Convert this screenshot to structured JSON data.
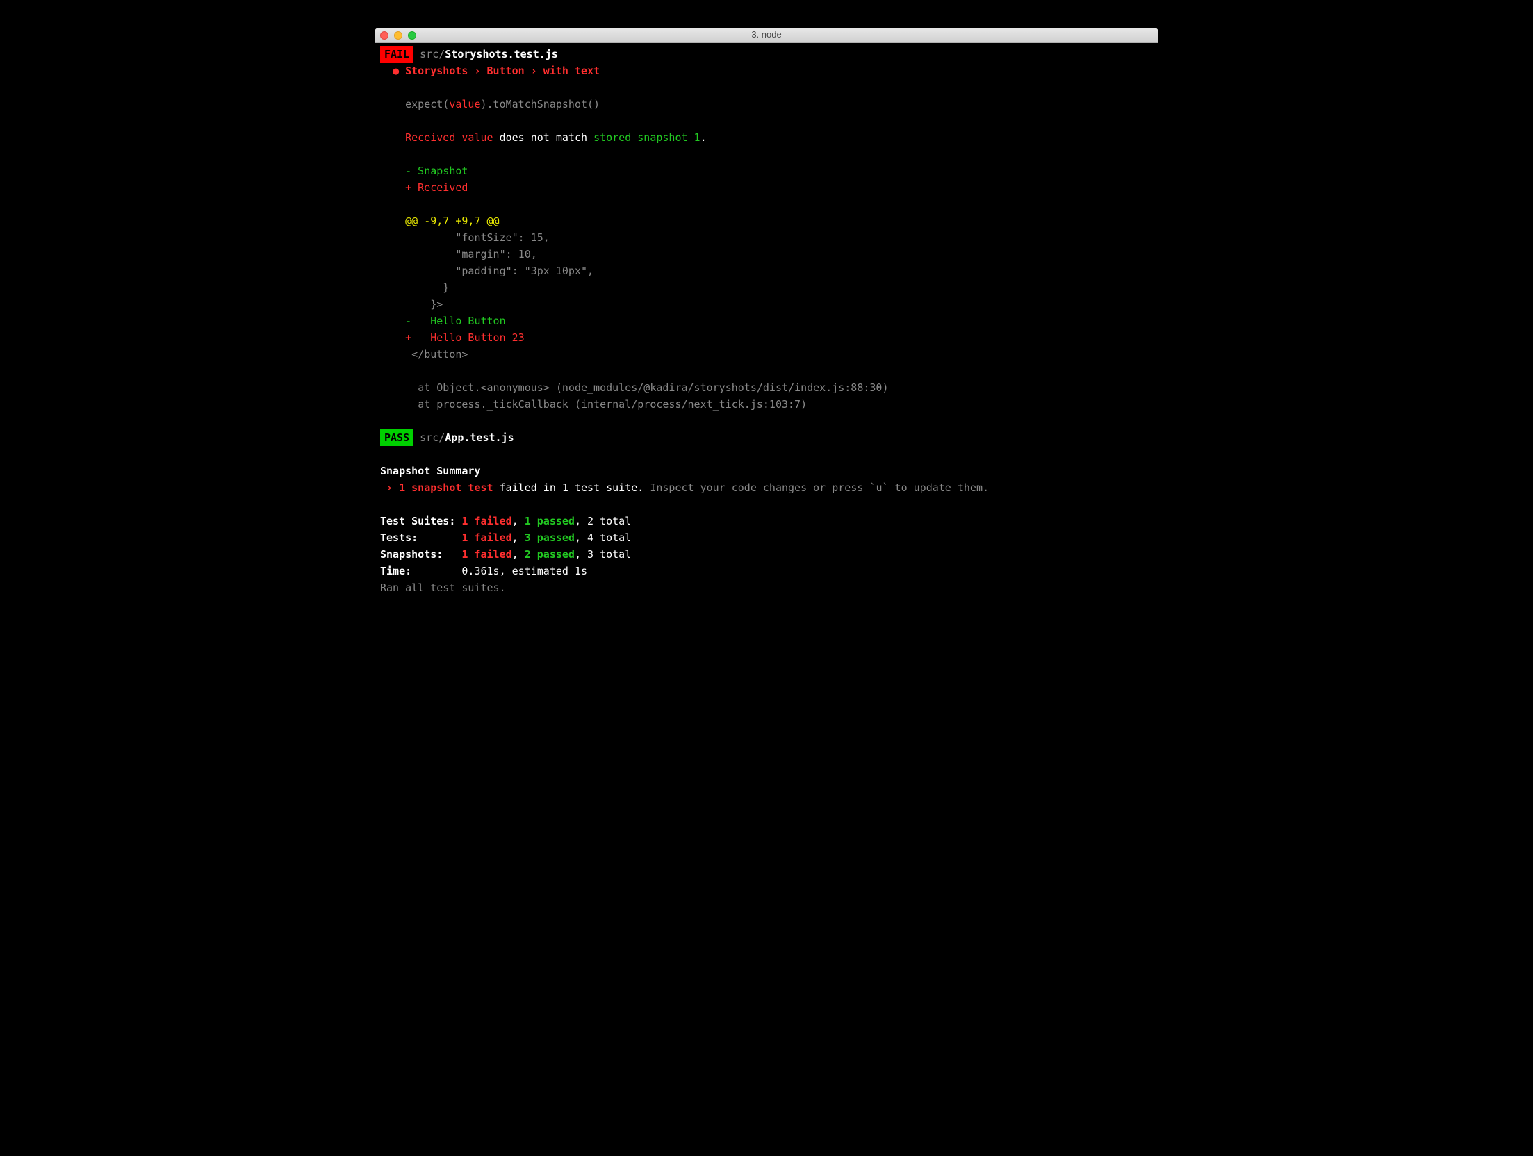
{
  "window": {
    "title": "3. node"
  },
  "fail": {
    "badge": "FAIL",
    "path_dir": "src/",
    "path_file": "Storyshots.test.js",
    "test_header": "Storyshots › Button › with text",
    "expect_plain1": "expect(",
    "expect_value": "value",
    "expect_plain2": ").toMatchSnapshot()",
    "received_value": "Received value",
    "does_not_match": " does not match ",
    "stored_snapshot": "stored snapshot 1",
    "period": ".",
    "minus_snapshot": "- Snapshot",
    "plus_received": "+ Received",
    "hunk": "@@ -9,7 +9,7 @@",
    "ctx_fontSize": "        \"fontSize\": 15,",
    "ctx_margin": "        \"margin\": 10,",
    "ctx_padding": "        \"padding\": \"3px 10px\",",
    "ctx_brace": "      }",
    "ctx_closeTag": "    }>",
    "del_line": "-   Hello Button",
    "add_line": "+   Hello Button 23",
    "ctx_closeBtn": " </button>",
    "stack1": "at Object.<anonymous> (node_modules/@kadira/storyshots/dist/index.js:88:30)",
    "stack2": "at process._tickCallback (internal/process/next_tick.js:103:7)"
  },
  "pass": {
    "badge": "PASS",
    "path_dir": "src/",
    "path_file": "App.test.js"
  },
  "summary": {
    "title": "Snapshot Summary",
    "arrow": " › ",
    "failed_tests": "1 snapshot test",
    "failed_rest": " failed in 1 test suite. ",
    "hint": "Inspect your code changes or press `u` to update them."
  },
  "totals": {
    "suites_label": "Test Suites: ",
    "suites_failed": "1 failed",
    "suites_passed": "1 passed",
    "suites_total": ", 2 total",
    "tests_label": "Tests:       ",
    "tests_failed": "1 failed",
    "tests_passed": "3 passed",
    "tests_total": ", 4 total",
    "snaps_label": "Snapshots:   ",
    "snaps_failed": "1 failed",
    "snaps_passed": "2 passed",
    "snaps_total": ", 3 total",
    "time_label": "Time:        ",
    "time_value": "0.361s, estimated 1s",
    "ran": "Ran all test suites."
  },
  "sep": ", "
}
